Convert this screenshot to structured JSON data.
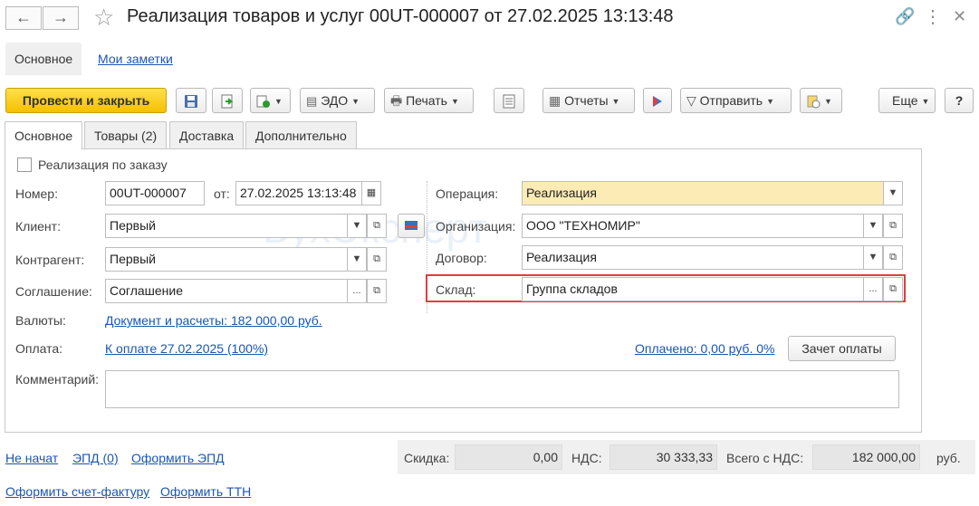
{
  "window": {
    "title": "Реализация товаров и услуг 00UT-000007 от 27.02.2025 13:13:48"
  },
  "top_tabs": [
    {
      "label": "Основное"
    },
    {
      "label": "Мои заметки"
    }
  ],
  "toolbar": {
    "post_close": "Провести и закрыть",
    "edo": "ЭДО",
    "print": "Печать",
    "reports": "Отчеты",
    "send": "Отправить",
    "more": "Еще",
    "help": "?"
  },
  "form_tabs": [
    {
      "label": "Основное"
    },
    {
      "label": "Товары (2)"
    },
    {
      "label": "Доставка"
    },
    {
      "label": "Дополнительно"
    }
  ],
  "form": {
    "by_order_label": "Реализация по заказу",
    "number_label": "Номер:",
    "number_value": "00UT-000007",
    "date_label": "от:",
    "date_value": "27.02.2025 13:13:48",
    "client_label": "Клиент:",
    "client_value": "Первый",
    "counterparty_label": "Контрагент:",
    "counterparty_value": "Первый",
    "agreement_label": "Соглашение:",
    "agreement_value": "Соглашение",
    "currency_label": "Валюты:",
    "currency_link": "Документ и расчеты: 182 000,00 руб.",
    "payment_label": "Оплата:",
    "payment_link": "К оплате 27.02.2025 (100%)",
    "paid_link": "Оплачено: 0,00 руб. 0%",
    "payment_offset_button": "Зачет оплаты",
    "comment_label": "Комментарий:",
    "comment_value": "",
    "operation_label": "Операция:",
    "operation_value": "Реализация",
    "organization_label": "Организация:",
    "organization_value": "ООО \"ТЕХНОМИР\"",
    "contract_label": "Договор:",
    "contract_value": "Реализация",
    "warehouse_label": "Склад:",
    "warehouse_value": "Группа складов"
  },
  "watermark": "БухЭксперт",
  "footer": {
    "links": [
      "Не начат",
      "ЭПД (0)",
      "Оформить ЭПД",
      "Оформить счет-фактуру",
      "Оформить ТТН"
    ],
    "discount_label": "Скидка:",
    "discount_value": "0,00",
    "vat_label": "НДС:",
    "vat_value": "30 333,33",
    "total_label": "Всего с НДС:",
    "total_value": "182 000,00",
    "currency": "руб."
  },
  "colors": {
    "primary_button": "#f5c000",
    "link": "#1a56b0",
    "highlight": "#e23d3d",
    "operation_field": "#fdebb5"
  }
}
